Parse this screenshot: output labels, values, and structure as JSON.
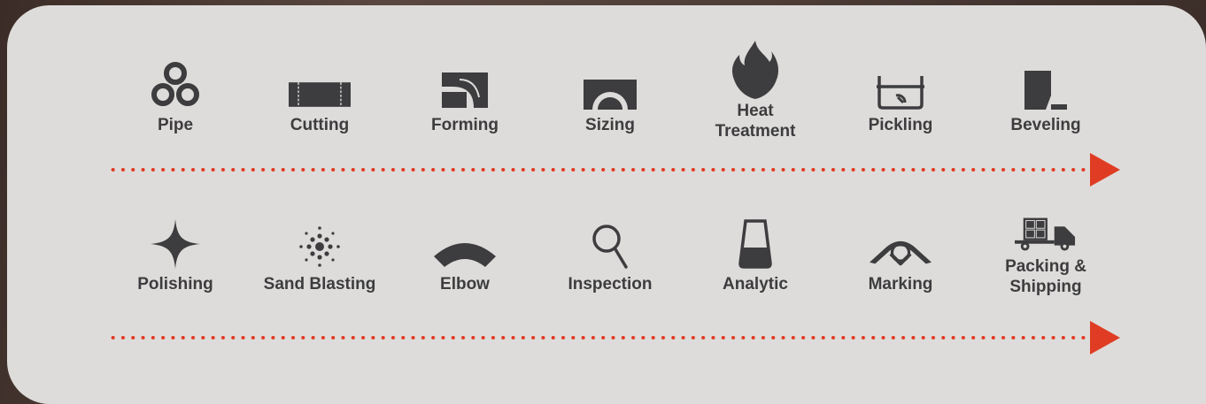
{
  "rows": [
    {
      "steps": [
        {
          "label": "Pipe",
          "icon": "pipe-bundle-icon"
        },
        {
          "label": "Cutting",
          "icon": "cutting-icon"
        },
        {
          "label": "Forming",
          "icon": "forming-icon"
        },
        {
          "label": "Sizing",
          "icon": "sizing-icon"
        },
        {
          "label": "Heat\nTreatment",
          "icon": "flame-icon"
        },
        {
          "label": "Pickling",
          "icon": "pickling-tank-icon"
        },
        {
          "label": "Beveling",
          "icon": "beveling-icon"
        }
      ]
    },
    {
      "steps": [
        {
          "label": "Polishing",
          "icon": "sparkle-icon"
        },
        {
          "label": "Sand Blasting",
          "icon": "sand-blast-icon"
        },
        {
          "label": "Elbow",
          "icon": "elbow-icon"
        },
        {
          "label": "Inspection",
          "icon": "magnifier-icon"
        },
        {
          "label": "Analytic",
          "icon": "beaker-icon"
        },
        {
          "label": "Marking",
          "icon": "marking-icon"
        },
        {
          "label": "Packing &\nShipping",
          "icon": "delivery-truck-icon"
        }
      ]
    }
  ],
  "colors": {
    "accent": "#e03c24",
    "icon": "#3d3d3f",
    "panel": "#dedcda"
  }
}
